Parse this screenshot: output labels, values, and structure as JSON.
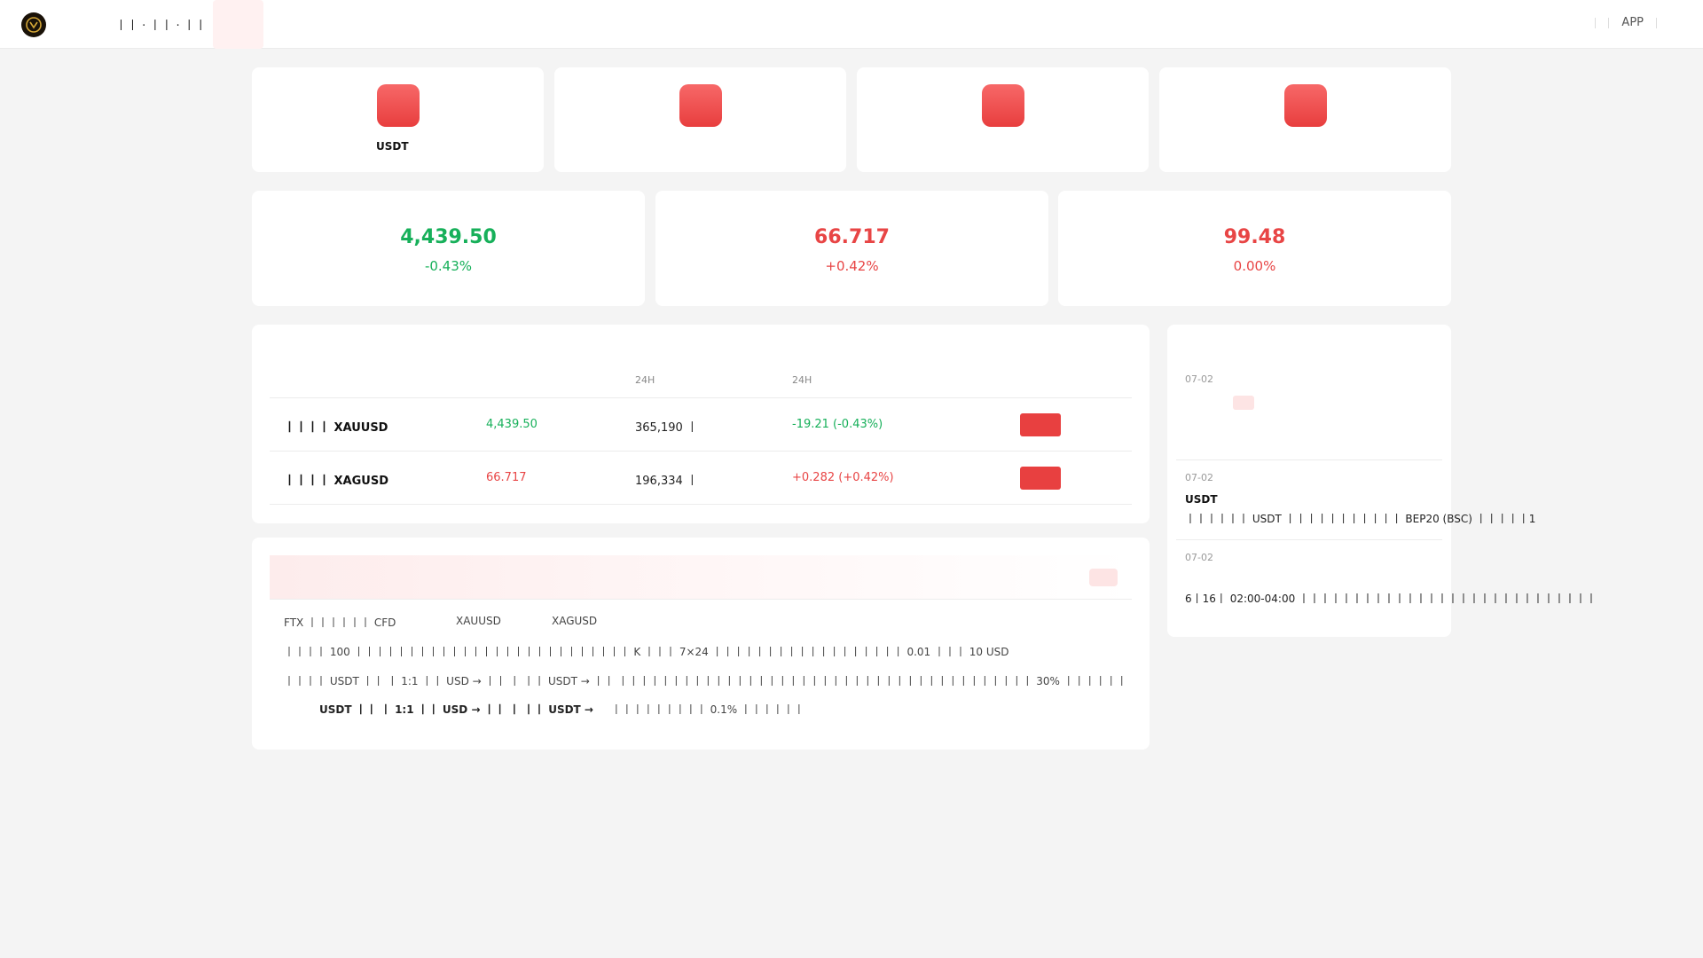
{
  "header": {
    "nav_text": "丨丨 · 丨丨 · 丨丨",
    "app_label": "APP"
  },
  "quick_actions": [
    {
      "label": "USDT"
    },
    {
      "label": ""
    },
    {
      "label": ""
    },
    {
      "label": ""
    }
  ],
  "tickers": [
    {
      "price": "4,439.50",
      "change": "-0.43%",
      "trend": "down"
    },
    {
      "price": "66.717",
      "change": "+0.42%",
      "trend": "up"
    },
    {
      "price": "99.48",
      "change": "0.00%",
      "trend": "up"
    }
  ],
  "market_table": {
    "headers": [
      "",
      "",
      "24H",
      "24H",
      ""
    ],
    "rows": [
      {
        "name": "丨丨丨丨 XAUUSD",
        "price": "4,439.50",
        "volume": "365,190 丨",
        "change": "-19.21 (-0.43%)",
        "trend": "down"
      },
      {
        "name": "丨丨丨丨 XAGUSD",
        "price": "66.717",
        "volume": "196,334 丨",
        "change": "+0.282 (+0.42%)",
        "trend": "up"
      }
    ]
  },
  "info": {
    "line1_prefix": "FTX 丨丨丨丨丨丨 CFD",
    "line1_sym1": "XAUUSD",
    "line1_sym2": "XAGUSD",
    "line2": "丨丨丨丨 100 丨丨丨丨丨丨丨丨丨丨丨丨丨丨丨丨丨丨丨丨丨丨丨丨丨丨 K 丨丨丨 7×24 丨丨丨丨丨丨丨丨丨丨丨丨丨丨丨丨丨丨 0.01 丨丨丨 10 USD",
    "line3": "丨丨丨丨 USDT 丨丨 丨 1:1 丨丨 USD → 丨丨 丨 丨丨 USDT → 丨丨 丨丨丨丨丨丨丨丨丨丨丨丨丨丨丨丨丨丨丨丨丨丨丨丨丨丨丨丨丨丨丨丨丨丨丨丨丨丨丨 30% 丨丨丨丨丨丨",
    "line4_bold": "USDT 丨丨 丨 1:1 丨丨 USD → 丨丨 丨 丨丨 USDT →",
    "line4_rest": "丨丨丨丨丨丨丨丨丨 0.1% 丨丨丨丨丨丨"
  },
  "news": [
    {
      "date": "07-02",
      "title": "",
      "body": ""
    },
    {
      "date": "07-02",
      "title": "USDT",
      "body": "丨丨丨丨丨丨 USDT 丨丨丨丨丨丨丨丨丨丨丨 BEP20 (BSC) 丨丨丨丨丨1"
    },
    {
      "date": "07-02",
      "title": "",
      "body": "6丨16丨 02:00-04:00 丨丨丨丨丨丨丨丨丨丨丨丨丨丨丨丨丨丨丨丨丨丨丨丨丨丨丨丨"
    }
  ],
  "colors": {
    "up": "#e84545",
    "down": "#17b05a",
    "accent": "#e84040"
  }
}
